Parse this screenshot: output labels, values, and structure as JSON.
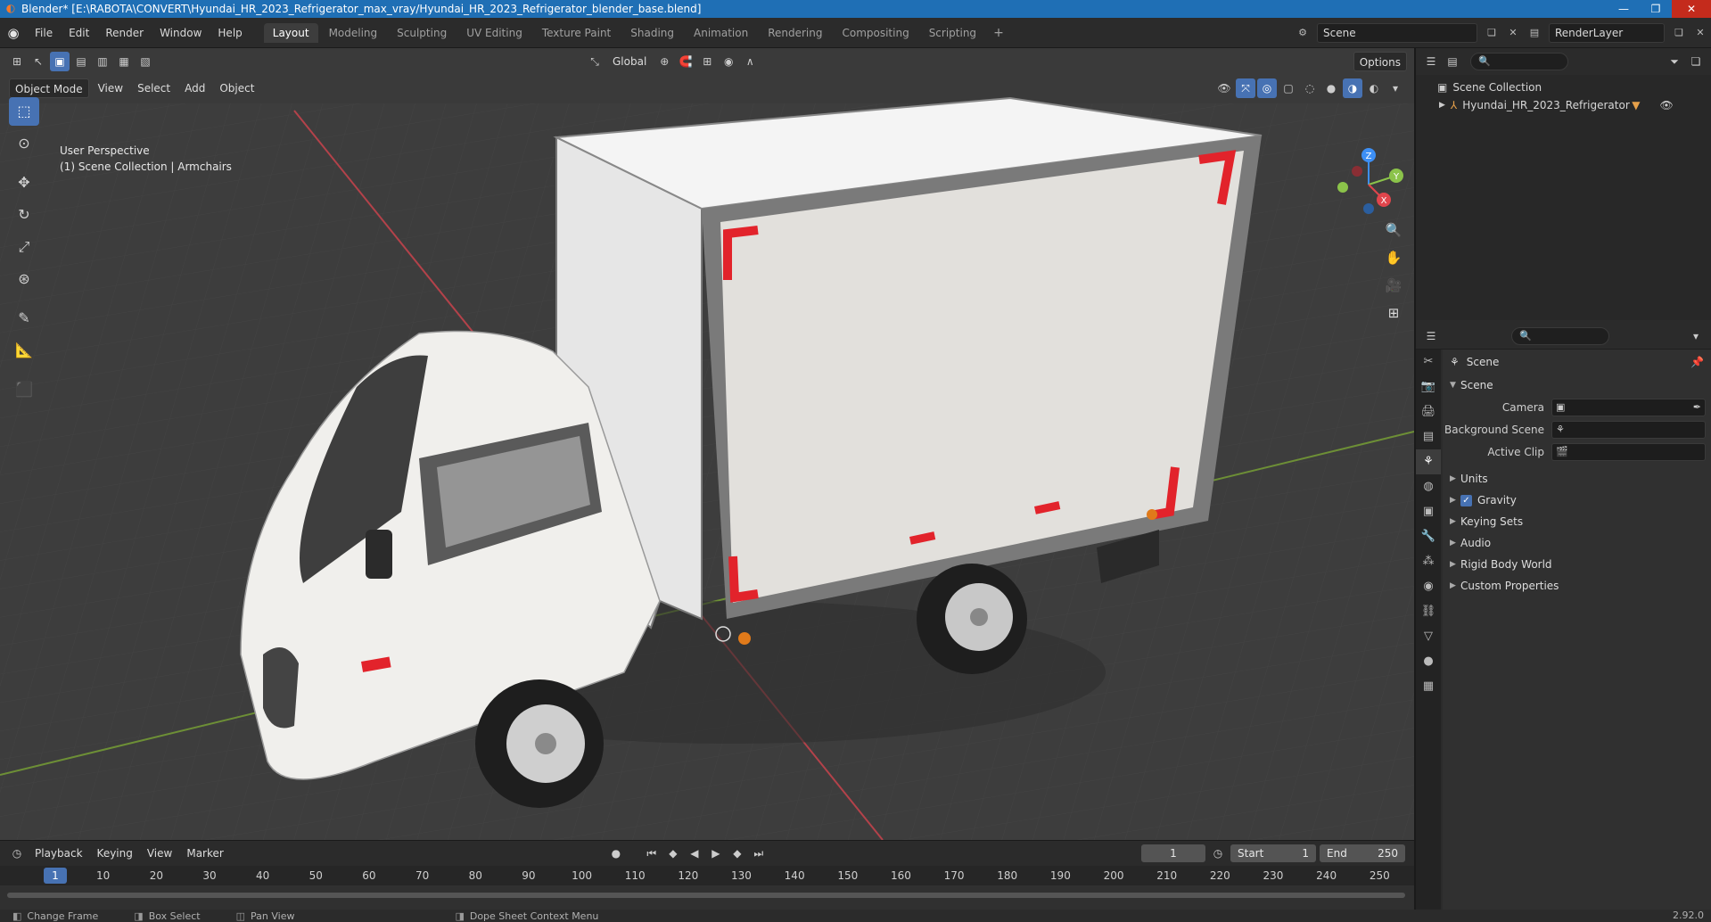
{
  "window": {
    "title": "Blender* [E:\\RABOTA\\CONVERT\\Hyundai_HR_2023_Refrigerator_max_vray/Hyundai_HR_2023_Refrigerator_blender_base.blend]"
  },
  "menu": [
    "File",
    "Edit",
    "Render",
    "Window",
    "Help"
  ],
  "workspaces": [
    "Layout",
    "Modeling",
    "Sculpting",
    "UV Editing",
    "Texture Paint",
    "Shading",
    "Animation",
    "Rendering",
    "Compositing",
    "Scripting"
  ],
  "scene_name": "Scene",
  "render_layer": "RenderLayer",
  "viewport": {
    "mode": "Object Mode",
    "menus": [
      "View",
      "Select",
      "Add",
      "Object"
    ],
    "transform_orientation": "Global",
    "options_label": "Options",
    "info_line1": "User Perspective",
    "info_line2": "(1) Scene Collection | Armchairs"
  },
  "gizmo": {
    "x": "X",
    "y": "Y",
    "z": "Z"
  },
  "timeline": {
    "menus": [
      "Playback",
      "Keying",
      "View",
      "Marker"
    ],
    "current_frame": "1",
    "start_label": "Start",
    "start": "1",
    "end_label": "End",
    "end": "250",
    "ticks": [
      "1",
      "10",
      "20",
      "30",
      "40",
      "50",
      "60",
      "70",
      "80",
      "90",
      "100",
      "110",
      "120",
      "130",
      "140",
      "150",
      "160",
      "170",
      "180",
      "190",
      "200",
      "210",
      "220",
      "230",
      "240",
      "250"
    ]
  },
  "status": {
    "items": [
      "Change Frame",
      "Box Select",
      "Pan View",
      "Dope Sheet Context Menu"
    ],
    "version": "2.92.0"
  },
  "outliner": {
    "root": "Scene Collection",
    "items": [
      "Hyundai_HR_2023_Refrigerator"
    ]
  },
  "properties": {
    "context": "Scene",
    "panel": "Scene",
    "fields": [
      {
        "label": "Camera"
      },
      {
        "label": "Background Scene"
      },
      {
        "label": "Active Clip"
      }
    ],
    "sections": [
      "Units",
      "Gravity",
      "Keying Sets",
      "Audio",
      "Rigid Body World",
      "Custom Properties"
    ]
  },
  "colors": {
    "accent": "#4772b3",
    "titlebar": "#1f6fb5",
    "axis_x": "#e0454c",
    "axis_y": "#8bc34a",
    "axis_z": "#3d8ff5"
  }
}
